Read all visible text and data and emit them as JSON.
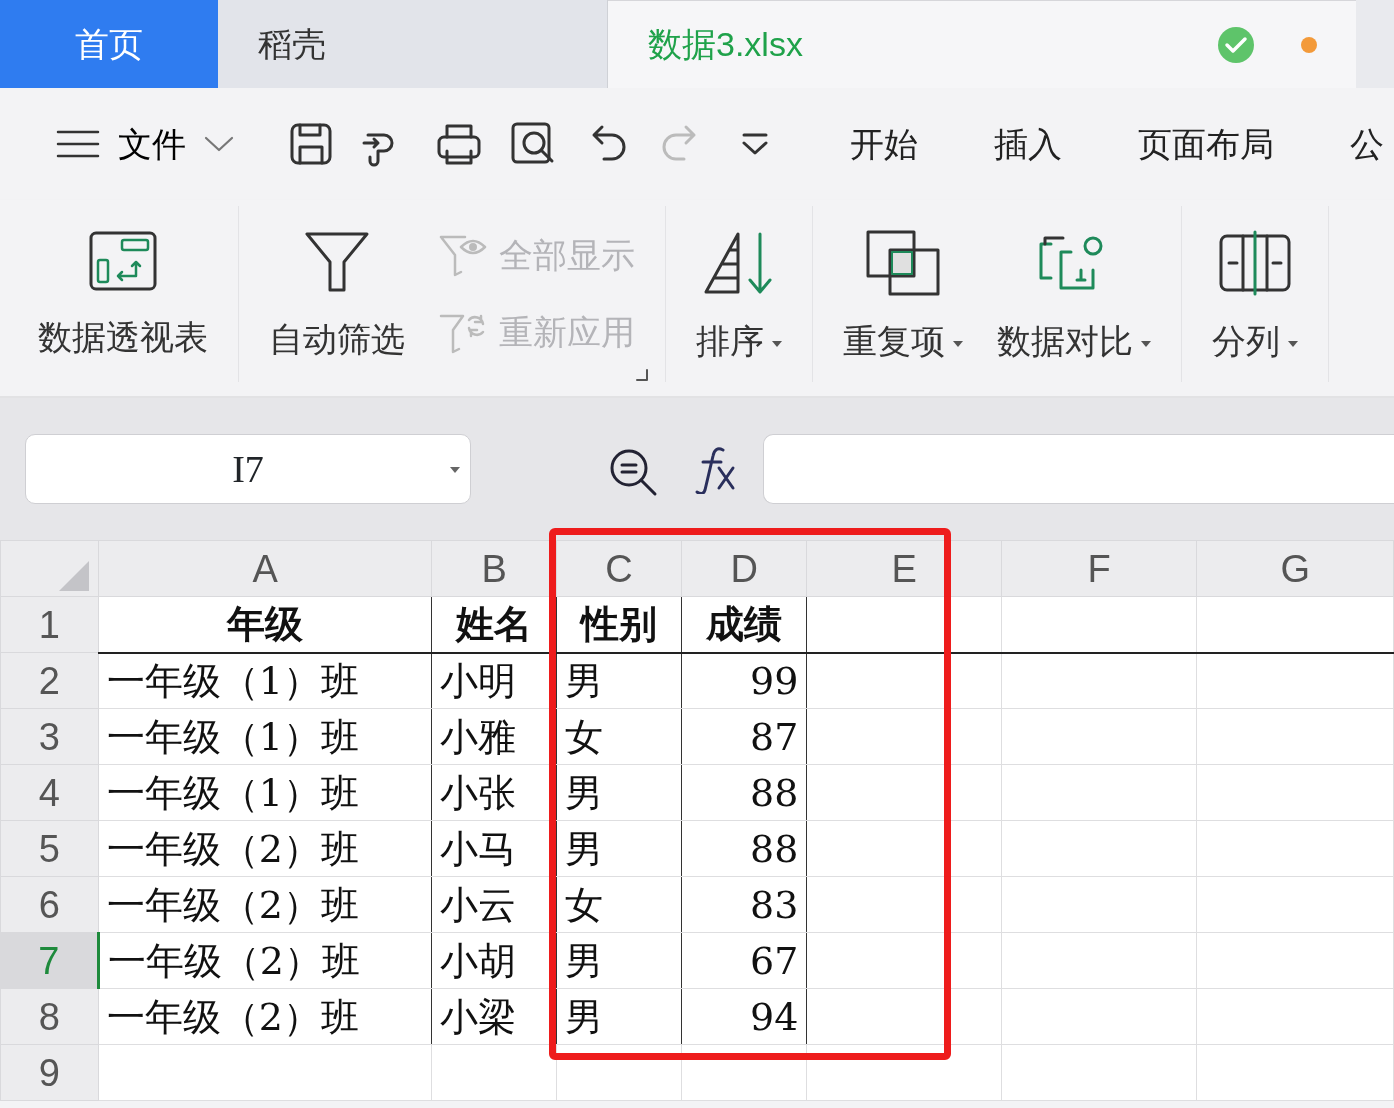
{
  "tabs": [
    {
      "label": "首页",
      "kind": "home",
      "selected": false
    },
    {
      "label": "稻壳",
      "kind": "docer",
      "selected": false
    },
    {
      "label": "数据3.xlsx",
      "kind": "sheet",
      "selected": true,
      "saved": true,
      "modified": true
    }
  ],
  "toolbar": {
    "file_menu": "文件",
    "menu_tabs": [
      "开始",
      "插入",
      "页面布局",
      "公"
    ]
  },
  "ribbon": {
    "groups": [
      {
        "items": [
          {
            "label": "数据透视表",
            "kind": "pivot",
            "disabled": false,
            "dropdown": false
          }
        ]
      },
      {
        "launcher": true,
        "items": [
          {
            "label": "自动筛选",
            "kind": "filter",
            "disabled": false,
            "dropdown": false
          }
        ],
        "stacked_items": [
          {
            "label": "全部显示",
            "kind": "show-all",
            "disabled": true,
            "dropdown": false
          },
          {
            "label": "重新应用",
            "kind": "reapply",
            "disabled": true,
            "dropdown": false
          }
        ]
      },
      {
        "items": [
          {
            "label": "排序",
            "kind": "sort",
            "disabled": false,
            "dropdown": true
          }
        ]
      },
      {
        "items": [
          {
            "label": "重复项",
            "kind": "duplicates",
            "disabled": false,
            "dropdown": true
          },
          {
            "label": "数据对比",
            "kind": "compare",
            "disabled": false,
            "dropdown": true
          }
        ]
      },
      {
        "items": [
          {
            "label": "分列",
            "kind": "split",
            "disabled": false,
            "dropdown": true
          }
        ]
      }
    ]
  },
  "formula_bar": {
    "name_box": "I7"
  },
  "columns": [
    {
      "label": "A",
      "right_aligned": false
    },
    {
      "label": "B",
      "right_aligned": false
    },
    {
      "label": "C",
      "right_aligned": false
    },
    {
      "label": "D",
      "right_aligned": true
    },
    {
      "label": "E"
    },
    {
      "label": "F"
    },
    {
      "label": "G"
    }
  ],
  "rows": [
    {
      "number": "1",
      "kind": "header",
      "selected": false,
      "cells": [
        "年级",
        "姓名",
        "性别",
        "成绩"
      ]
    },
    {
      "number": "2",
      "kind": "data",
      "selected": false,
      "cells": [
        "一年级（1）班",
        "小明",
        "男",
        "99"
      ]
    },
    {
      "number": "3",
      "kind": "data",
      "selected": false,
      "cells": [
        "一年级（1）班",
        "小雅",
        "女",
        "87"
      ]
    },
    {
      "number": "4",
      "kind": "data",
      "selected": false,
      "cells": [
        "一年级（1）班",
        "小张",
        "男",
        "88"
      ]
    },
    {
      "number": "5",
      "kind": "data",
      "selected": false,
      "cells": [
        "一年级（2）班",
        "小马",
        "男",
        "88"
      ]
    },
    {
      "number": "6",
      "kind": "data",
      "selected": false,
      "cells": [
        "一年级（2）班",
        "小云",
        "女",
        "83"
      ]
    },
    {
      "number": "7",
      "kind": "data",
      "selected": true,
      "cells": [
        "一年级（2）班",
        "小胡",
        "男",
        "67"
      ]
    },
    {
      "number": "8",
      "kind": "data",
      "selected": false,
      "cells": [
        "一年级（2）班",
        "小梁",
        "男",
        "94"
      ]
    },
    {
      "number": "9",
      "kind": "empty",
      "selected": false,
      "cells": []
    }
  ],
  "highlight_frame": {
    "color": "#ee1c1c"
  }
}
